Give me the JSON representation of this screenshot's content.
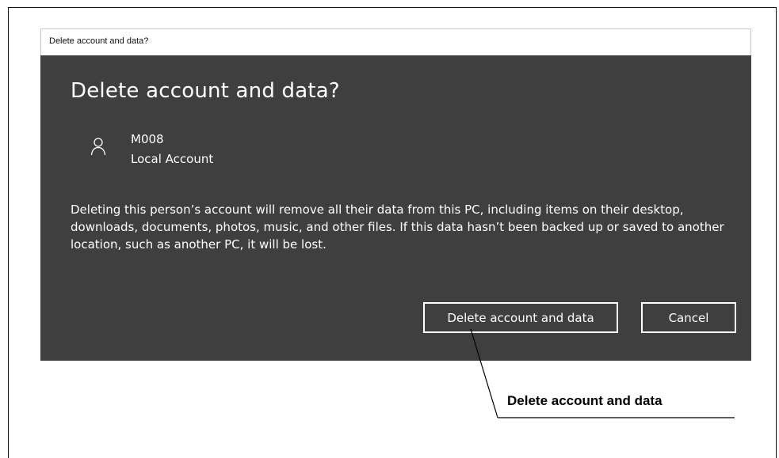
{
  "window": {
    "title": "Delete account and data?"
  },
  "dialog": {
    "heading": "Delete account and data?",
    "user": {
      "icon": "person-icon",
      "name": "M008",
      "type": "Local Account"
    },
    "description": "Deleting this person’s account will remove all their data from this PC, including items on their desktop, downloads, documents, photos, music, and other files. If this data hasn’t been backed up or saved to another location, such as another PC, it will be lost.",
    "buttons": {
      "delete_label": "Delete account and data",
      "cancel_label": "Cancel"
    },
    "colors": {
      "background": "#3f3f3f",
      "text": "#ffffff"
    }
  },
  "callout": {
    "label": "Delete account and data"
  }
}
